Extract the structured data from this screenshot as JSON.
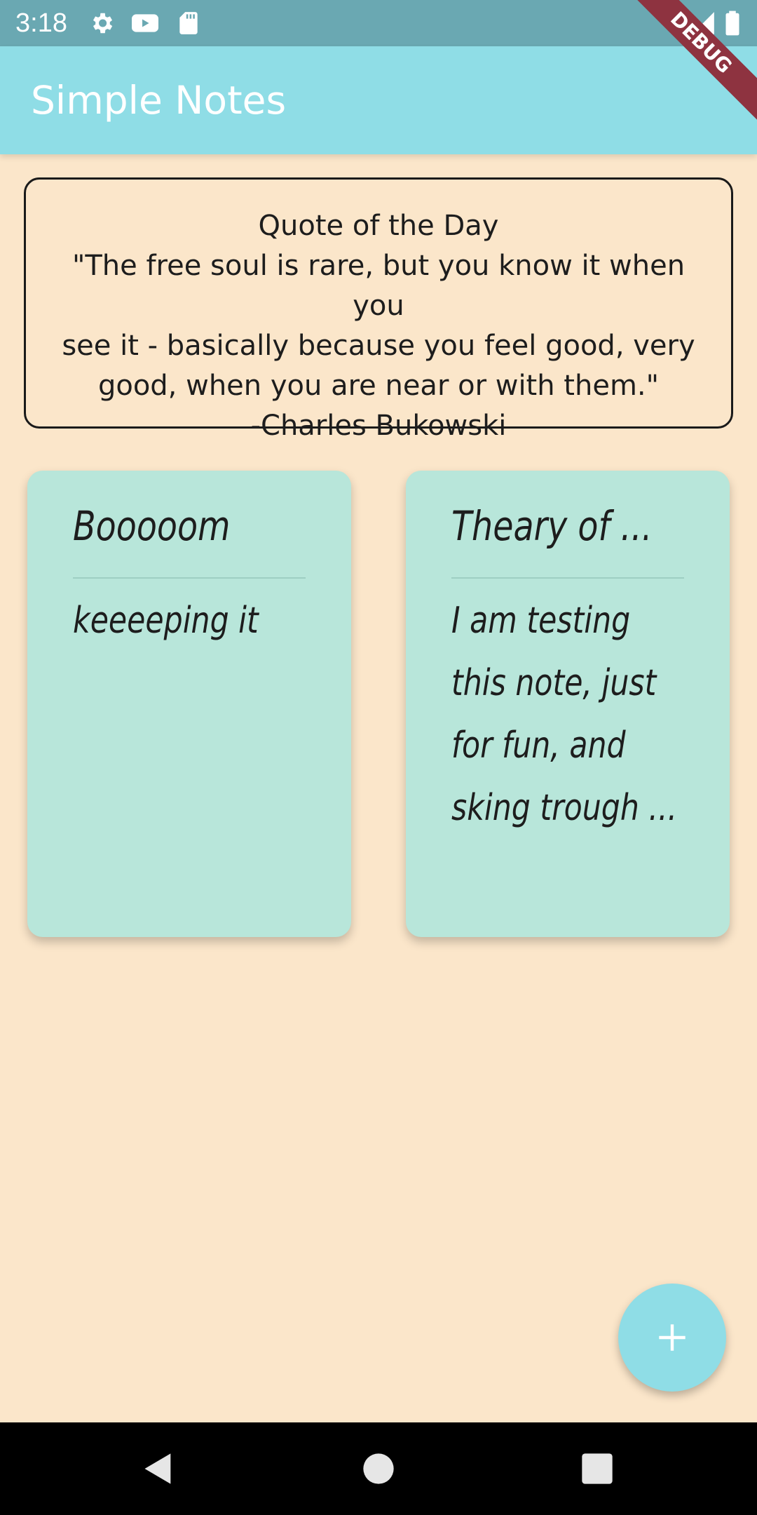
{
  "status_bar": {
    "time": "3:18",
    "icons": [
      "gear-icon",
      "youtube-icon",
      "sd-card-icon",
      "wifi-icon",
      "signal-icon",
      "battery-icon"
    ]
  },
  "debug_banner": "DEBUG",
  "app_bar": {
    "title": "Simple Notes",
    "color": "#8fdde6"
  },
  "quote": {
    "heading": "Quote of the Day",
    "lines": [
      "\"The free soul is rare, but you know it when you",
      "see it - basically because you feel good, very",
      "good, when you are near or with them.\"",
      "-Charles Bukowski"
    ]
  },
  "notes": [
    {
      "title": "Booooom",
      "body_lines": [
        "keeeeping it"
      ],
      "color": "#b8e6da"
    },
    {
      "title": "Theary of ...",
      "body_lines": [
        "I am testing",
        "this note, just",
        "for fun, and",
        "sking trough ..."
      ],
      "color": "#b8e6da"
    }
  ],
  "fab": {
    "icon": "plus-icon",
    "color": "#8fdde6"
  },
  "nav_bar": {
    "buttons": [
      "back-icon",
      "home-icon",
      "recents-icon"
    ]
  }
}
